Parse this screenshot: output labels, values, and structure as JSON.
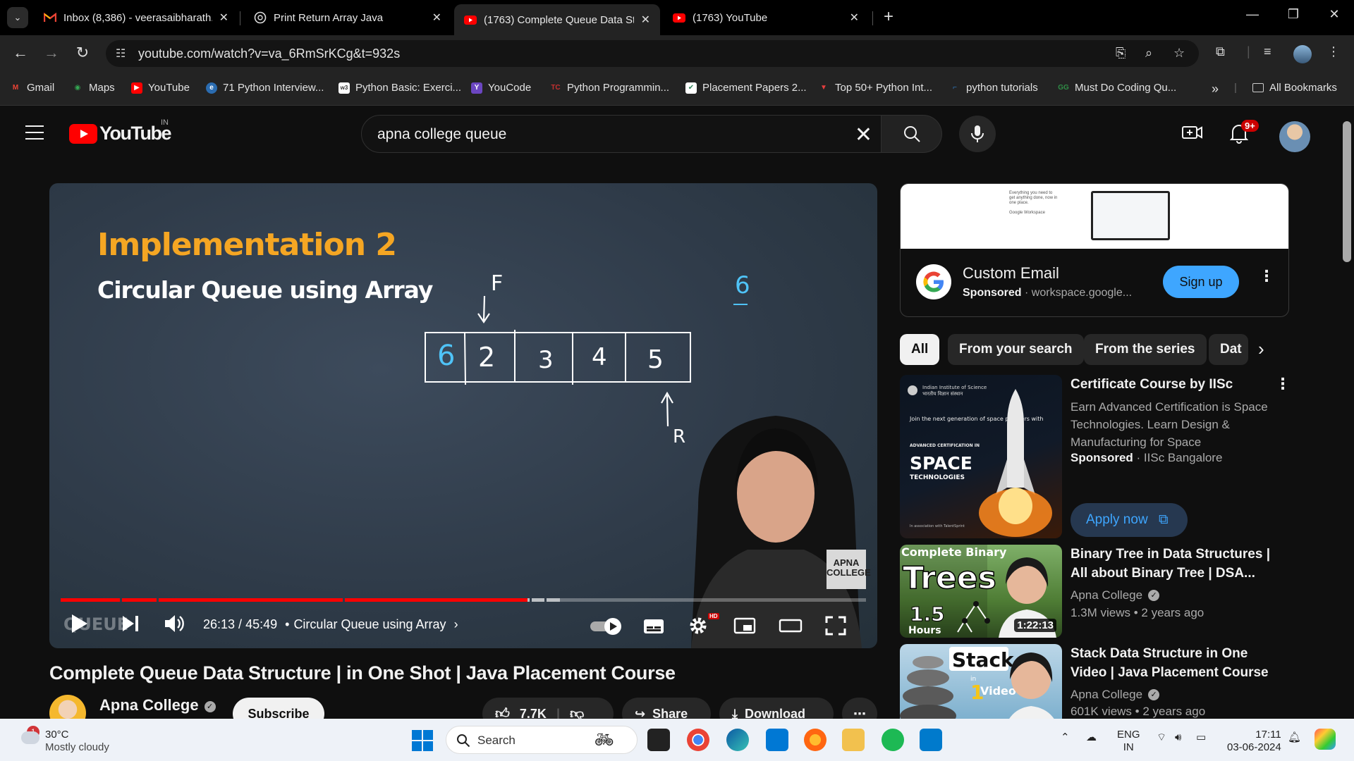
{
  "browser": {
    "tabs": [
      {
        "title": "Inbox (8,386) - veerasaibharath.",
        "favicon": "gmail-icon"
      },
      {
        "title": "Print Return Array Java",
        "favicon": "chatgpt-icon"
      },
      {
        "title": "(1763) Complete Queue Data St",
        "favicon": "youtube-icon",
        "active": true
      },
      {
        "title": "(1763) YouTube",
        "favicon": "youtube-icon"
      }
    ],
    "url": "youtube.com/watch?v=va_6RmSrKCg&t=932s",
    "bookmarks": [
      "Gmail",
      "Maps",
      "YouTube",
      "71 Python Interview...",
      "Python Basic: Exerci...",
      "YouCode",
      "Python Programmin...",
      "Placement Papers 2...",
      "Top 50+ Python Int...",
      "python tutorials",
      "Must Do Coding Qu..."
    ],
    "all_bookmarks": "All Bookmarks",
    "bookmarks_overflow": "»"
  },
  "youtube": {
    "logo_text": "YouTube",
    "country_code": "IN",
    "search_query": "apna college queue",
    "notification_count": "9+"
  },
  "player": {
    "slide_title": "Implementation 2",
    "slide_subtitle": "Circular Queue using Array",
    "board": {
      "front_label": "F",
      "rear_label": "R",
      "side_value": "6",
      "cells": [
        "6",
        "2",
        "3",
        "4",
        "5"
      ]
    },
    "watermark": "QUEUE",
    "channel_logo": "APNA COLLEGE",
    "time_current": "26:13",
    "time_total": "45:49",
    "chapter": "Circular Queue using Array",
    "hd_badge": "HD",
    "progress_played": 0.58
  },
  "video": {
    "title": "Complete Queue Data Structure | in One Shot | Java Placement Course",
    "channel": "Apna College",
    "subscribe": "Subscribe",
    "likes": "7.7K",
    "share": "Share",
    "download": "Download"
  },
  "ad": {
    "banner_text": "Everything you need to get anything done, now in one place.",
    "banner_brand": "Google Workspace",
    "title": "Custom Email",
    "sponsored": "Sponsored",
    "domain": "workspace.google...",
    "cta": "Sign up"
  },
  "chips": [
    "All",
    "From your search",
    "From the series",
    "Dat"
  ],
  "recommendations": [
    {
      "title": "Certificate Course by IISc",
      "description": "Earn Advanced Certification is Space Technologies. Learn Design & Manufacturing for Space",
      "sponsored": "Sponsored",
      "channel": "IISc Bangalore",
      "cta": "Apply now",
      "thumb": {
        "org": "Indian Institute of Science",
        "org_hindi": "भारतीय विज्ञान संस्थान",
        "tagline": "Join the next generation of space pioneers with",
        "cert": "ADVANCED CERTIFICATION IN",
        "big": "SPACE",
        "sub": "TECHNOLOGIES",
        "footer": "In association with TalentSprint"
      }
    },
    {
      "title": "Binary Tree in Data Structures | All about Binary Tree | DSA...",
      "channel": "Apna College",
      "meta": "1.3M views • 2 years ago",
      "duration": "1:22:13",
      "thumb": {
        "top": "Complete Binary",
        "big": "Trees",
        "hours": "1.5",
        "hours_label": "Hours"
      }
    },
    {
      "title": "Stack Data Structure in One Video | Java Placement Course",
      "channel": "Apna College",
      "meta": "601K views • 2 years ago",
      "thumb": {
        "big": "Stack",
        "in": "in",
        "num": "1",
        "video": "Video"
      }
    }
  ],
  "taskbar": {
    "weather_temp": "30°C",
    "weather_desc": "Mostly cloudy",
    "weather_badge": "1",
    "search": "Search",
    "lang": "ENG",
    "region": "IN",
    "time": "17:11",
    "date": "03-06-2024"
  }
}
